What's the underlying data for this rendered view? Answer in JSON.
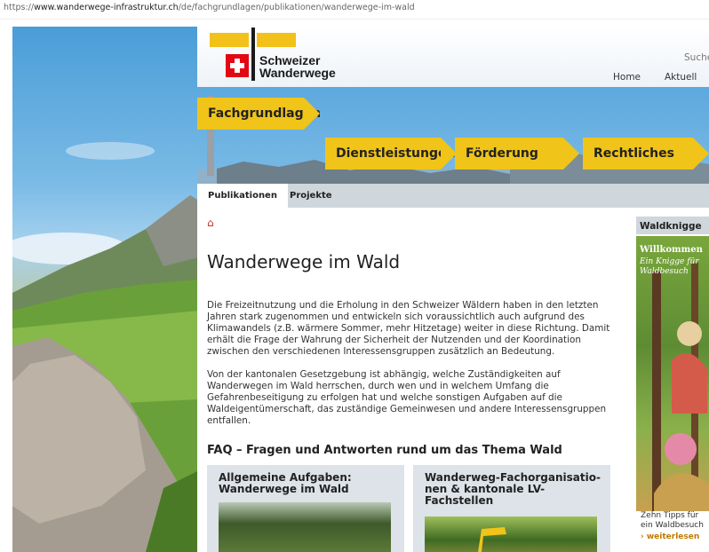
{
  "browser": {
    "url_prefix": "https://",
    "url_host": "www.wanderwege-infrastruktur.ch",
    "url_path": "/de/fachgrundlagen/publikationen/wanderwege-im-wald"
  },
  "brand": {
    "line1": "Schweizer",
    "line2": "Wanderwege",
    "sign_color": "#f2c21a",
    "flag_color": "#e30613"
  },
  "search": {
    "placeholder": "Suche"
  },
  "topnav": {
    "home": "Home",
    "aktuell": "Aktuell"
  },
  "mainnav": {
    "fachgrundlagen": "Fachgrundlagen",
    "dienstleistungen": "Dienstleistungen",
    "foerderung": "Förderung",
    "rechtliches": "Rechtliches"
  },
  "subnav": {
    "publikationen": "Publikationen",
    "projekte": "Projekte"
  },
  "page": {
    "title": "Wanderwege im Wald",
    "para1": "Die Freizeitnutzung und die Erholung in den Schweizer Wäldern haben in den letzten Jahren stark zugenommen und entwickeln sich voraussichtlich auch aufgrund des Klimawandels (z.B. wärmere Sommer, mehr Hitzetage) weiter in diese Richtung. Damit erhält die Frage der Wahrung der Sicherheit der Nutzenden und der Koordination zwischen den verschiedenen Interessensgruppen zusätzlich an Bedeutung.",
    "para2": "Von der kantonalen Gesetzgebung ist abhängig, welche Zuständigkeiten auf Wanderwegen im Wald herrschen, durch wen und in welchem Umfang die Gefahrenbeseitigung zu erfolgen hat und welche sonstigen Aufgaben auf die Waldeigentümerschaft, das zuständige Gemein­wesen und andere Interessensgruppen entfallen.",
    "faq_heading": "FAQ – Fragen und Antworten rund um das Thema Wald",
    "cards": [
      {
        "title": "Allgemeine Aufgaben: Wander­wege im Wald"
      },
      {
        "title": "Wanderweg-Fachorganisatio­nen & kantonale LV-Fachstellen"
      }
    ]
  },
  "sidebar": {
    "heading": "Waldknigge",
    "img_line1": "Willkommen",
    "img_line2": "Ein Knigge für",
    "img_line3": "Waldbesuch",
    "caption": "Zehn Tipps für ein Waldbesuch",
    "more": "weiterlesen"
  }
}
